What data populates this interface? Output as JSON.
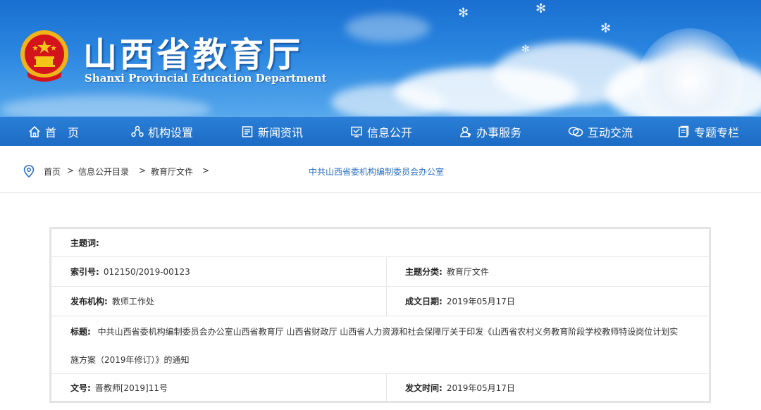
{
  "header": {
    "title": "山西省教育厅",
    "subtitle": "Shanxi Provincial Education Department",
    "emblem_icon": "national-emblem-icon"
  },
  "nav": {
    "items": [
      {
        "label": "首　页",
        "icon": "home-icon"
      },
      {
        "label": "机构设置",
        "icon": "org-icon"
      },
      {
        "label": "新闻资讯",
        "icon": "news-icon"
      },
      {
        "label": "信息公开",
        "icon": "info-icon"
      },
      {
        "label": "办事服务",
        "icon": "service-icon"
      },
      {
        "label": "互动交流",
        "icon": "chat-icon"
      },
      {
        "label": "专题专栏",
        "icon": "column-icon"
      }
    ]
  },
  "breadcrumb": {
    "items": [
      "首页",
      "信息公开目录",
      "教育厅文件"
    ],
    "separator": ">",
    "extra": "中共山西省委机构编制委员会办公室"
  },
  "info": {
    "subject_words_label": "主题词:",
    "subject_words_value": "",
    "index_label": "索引号:",
    "index_value": "012150/2019-00123",
    "category_label": "主题分类:",
    "category_value": "教育厅文件",
    "publisher_label": "发布机构:",
    "publisher_value": "教师工作处",
    "created_label": "成文日期:",
    "created_value": "2019年05月17日",
    "title_label": "标题:",
    "title_line1": "中共山西省委机构编制委员会办公室山西省教育厅 山西省财政厅 山西省人力资源和社会保障厅关于印发《山西省农村义务教育阶段学校教师特设岗位计划实",
    "title_line2": "施方案（2019年修订）》的通知",
    "doc_no_label": "文号:",
    "doc_no_value": "晋教师[2019]11号",
    "issued_label": "发文时间:",
    "issued_value": "2019年05月17日"
  },
  "colors": {
    "nav_bg": "#1c6bc4",
    "link": "#2a6fc4",
    "emblem_red": "#d4141c",
    "emblem_gold": "#f5c518"
  }
}
